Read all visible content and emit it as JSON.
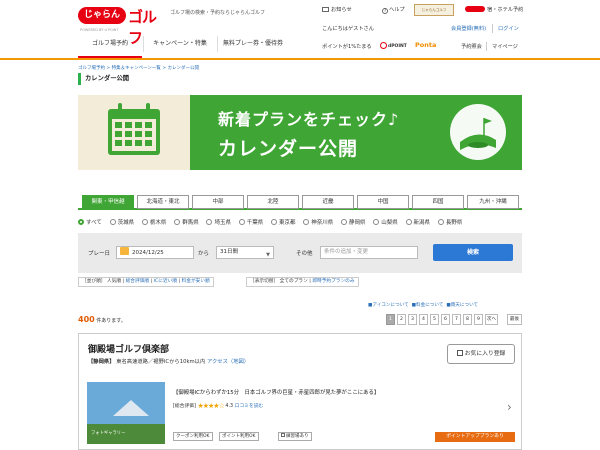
{
  "header": {
    "logo_text": "じゃらん",
    "logo_golf": "ゴルフ",
    "logo_sub": "POWERED BY d POINT",
    "tagline": "ゴルフ場の検索・予約ならじゃらんゴルフ",
    "notice_label": "お知らせ",
    "help_label": "ヘルプ",
    "badge_text": "じゃらんゴルフ",
    "hotel_link": "宿・ホテル予約",
    "greeting": "こんにちはゲストさん",
    "register_link": "会員登録(無料)",
    "login_link": "ログイン",
    "points_text": "ポイントが1%たまる",
    "dpoint_label": "dPOINT",
    "ponta_label": "Ponta",
    "reservation_check": "予約照会",
    "mypage": "マイページ"
  },
  "nav": {
    "tabs": [
      {
        "label": "ゴルフ場予約"
      },
      {
        "label": "キャンペーン・特集"
      },
      {
        "label": "無料プレー券・優待券"
      }
    ]
  },
  "breadcrumb": "ゴルフ場予約 > 特集＆キャンペーン一覧 > カレンダー公開",
  "page_title": "カレンダー公開",
  "banner": {
    "line1": "新着プランをチェック♪",
    "line2": "カレンダー公開"
  },
  "regions": [
    {
      "label": "関東・甲信越"
    },
    {
      "label": "北海道・東北"
    },
    {
      "label": "中部"
    },
    {
      "label": "北陸"
    },
    {
      "label": "近畿"
    },
    {
      "label": "中国"
    },
    {
      "label": "四国"
    },
    {
      "label": "九州・沖縄"
    }
  ],
  "prefectures": [
    {
      "label": "すべて"
    },
    {
      "label": "茨城県"
    },
    {
      "label": "栃木県"
    },
    {
      "label": "群馬県"
    },
    {
      "label": "埼玉県"
    },
    {
      "label": "千葉県"
    },
    {
      "label": "東京都"
    },
    {
      "label": "神奈川県"
    },
    {
      "label": "静岡県"
    },
    {
      "label": "山梨県"
    },
    {
      "label": "新潟県"
    },
    {
      "label": "長野県"
    }
  ],
  "search": {
    "play_date_label": "プレー日",
    "date_value": "2024/12/25",
    "from_label": "から",
    "period_value": "31日間",
    "other_label": "その他",
    "condition_placeholder": "条件の追加・変更",
    "search_button": "検索"
  },
  "filters": {
    "sort_label": "［並び順］",
    "sort_options": [
      "人気順",
      "総合評価順",
      "ICに近い順",
      "料金が安い順"
    ],
    "display_label": "［表示切替］",
    "display_options": [
      "全てのプラン",
      "即時予約プランのみ"
    ]
  },
  "info_links": {
    "icon_about": "アイコンについて",
    "fee_about": "料金について",
    "cancel_about": "雨天について"
  },
  "results": {
    "count": "400",
    "suffix": "件あります。",
    "pages": [
      "1",
      "2",
      "3",
      "4",
      "5",
      "6",
      "7",
      "8",
      "9"
    ],
    "next": "次へ",
    "last": "最後"
  },
  "card": {
    "name": "御殿場ゴルフ倶楽部",
    "pref": "【静岡県】",
    "access_text": "東名高速道路／裾野ICから10km以内",
    "access_link": "アクセス（地図）",
    "fav_button": "お気に入り登録",
    "photo_caption": "フォトギャラリー",
    "description": "【御殿場ICからわずか15分　日本ゴルフ界の巨星・赤星四郎が見た夢がここにある】",
    "rating_label": "[総合評価]",
    "rating": 4.3,
    "rating_text": "4.3",
    "reviews_link": "口コミを読む",
    "tags": [
      "クーポン利用OK",
      "ポイント利用OK",
      "練習場あり"
    ],
    "point_up": "ポイントアッププランあり"
  },
  "colors": {
    "brand_red": "#e60012",
    "green": "#3fa535",
    "search_blue": "#2b79d4",
    "orange": "#e76b10"
  }
}
